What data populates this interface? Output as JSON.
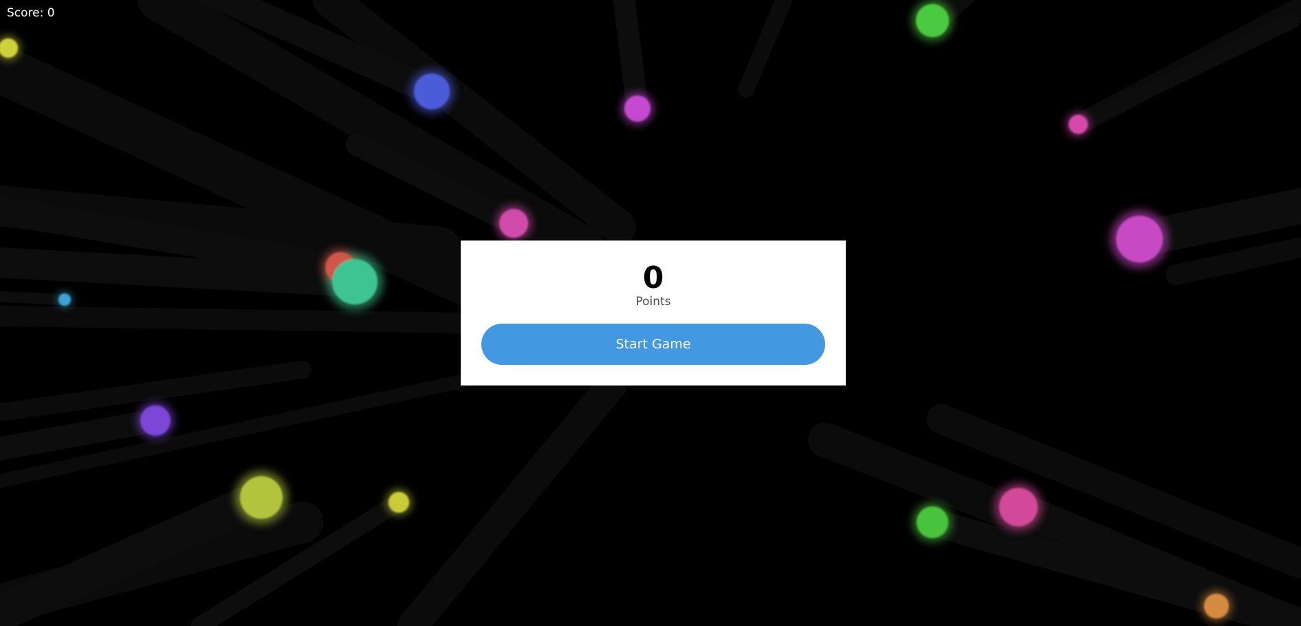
{
  "hud": {
    "score_label": "Score: 0"
  },
  "modal": {
    "points_value": "0",
    "points_caption": "Points",
    "start_button_label": "Start Game"
  },
  "colors": {
    "background": "#000000",
    "button": "#4299e1",
    "modal_bg": "#ffffff",
    "trail": "#111111"
  },
  "particles": [
    {
      "name": "particle-yellow-top-left",
      "color": "#cfd13a"
    },
    {
      "name": "particle-blue",
      "color": "#4b5bd8"
    },
    {
      "name": "particle-magenta-top",
      "color": "#c54ad1"
    },
    {
      "name": "particle-green-top",
      "color": "#4bc93f"
    },
    {
      "name": "particle-pink-top-right",
      "color": "#d44aa9"
    },
    {
      "name": "particle-pink-center",
      "color": "#d04bab"
    },
    {
      "name": "particle-magenta-right",
      "color": "#c849c4"
    },
    {
      "name": "particle-red",
      "color": "#d2554a"
    },
    {
      "name": "particle-teal",
      "color": "#3ec492"
    },
    {
      "name": "particle-cyan",
      "color": "#3aa3d6"
    },
    {
      "name": "particle-purple",
      "color": "#7b47d6"
    },
    {
      "name": "particle-olive-large",
      "color": "#b2c43e"
    },
    {
      "name": "particle-yellow-small",
      "color": "#c9cc38"
    },
    {
      "name": "particle-green-bottom",
      "color": "#4ac23e"
    },
    {
      "name": "particle-pink-bottom",
      "color": "#d34a99"
    },
    {
      "name": "particle-orange",
      "color": "#d68c3f"
    }
  ]
}
